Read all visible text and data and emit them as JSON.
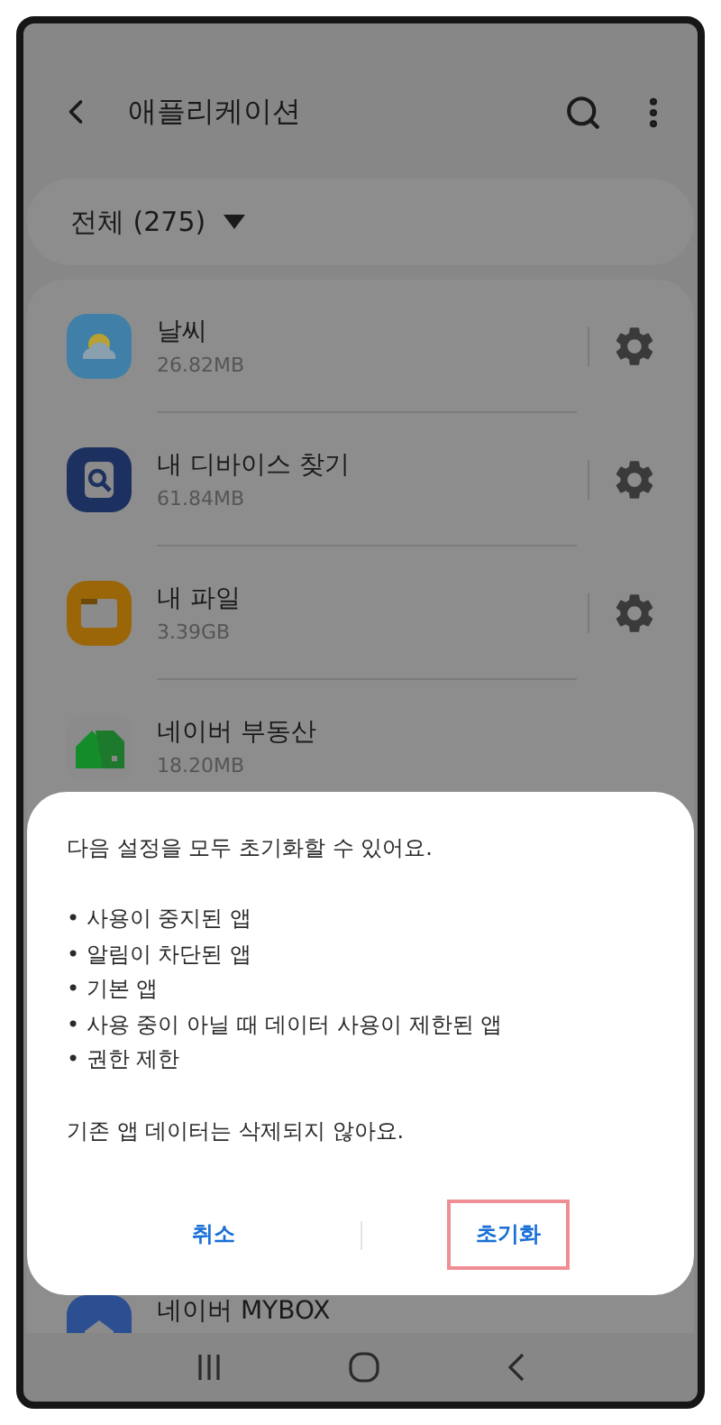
{
  "header": {
    "title": "애플리케이션"
  },
  "filter": {
    "label": "전체 (275)"
  },
  "apps": [
    {
      "name": "날씨",
      "size": "26.82MB",
      "kind": "weather",
      "settings": true
    },
    {
      "name": "내 디바이스 찾기",
      "size": "61.84MB",
      "kind": "finder",
      "settings": true
    },
    {
      "name": "내 파일",
      "size": "3.39GB",
      "kind": "folder",
      "settings": true
    },
    {
      "name": "네이버 부동산",
      "size": "18.20MB",
      "kind": "house",
      "settings": false
    }
  ],
  "app_under_dialog": {
    "name": "네이버 MYBOX",
    "kind": "cloud"
  },
  "dialog": {
    "message": "다음 설정을 모두 초기화할 수 있어요.",
    "items": [
      "• 사용이 중지된 앱",
      "• 알림이 차단된 앱",
      "• 기본 앱",
      "• 사용 중이 아닐 때 데이터 사용이 제한된 앱",
      "• 권한 제한"
    ],
    "note": "기존 앱 데이터는 삭제되지 않아요.",
    "buttons": [
      {
        "label": "취소",
        "highlighted": false
      },
      {
        "label": "초기화",
        "highlighted": true
      }
    ]
  }
}
